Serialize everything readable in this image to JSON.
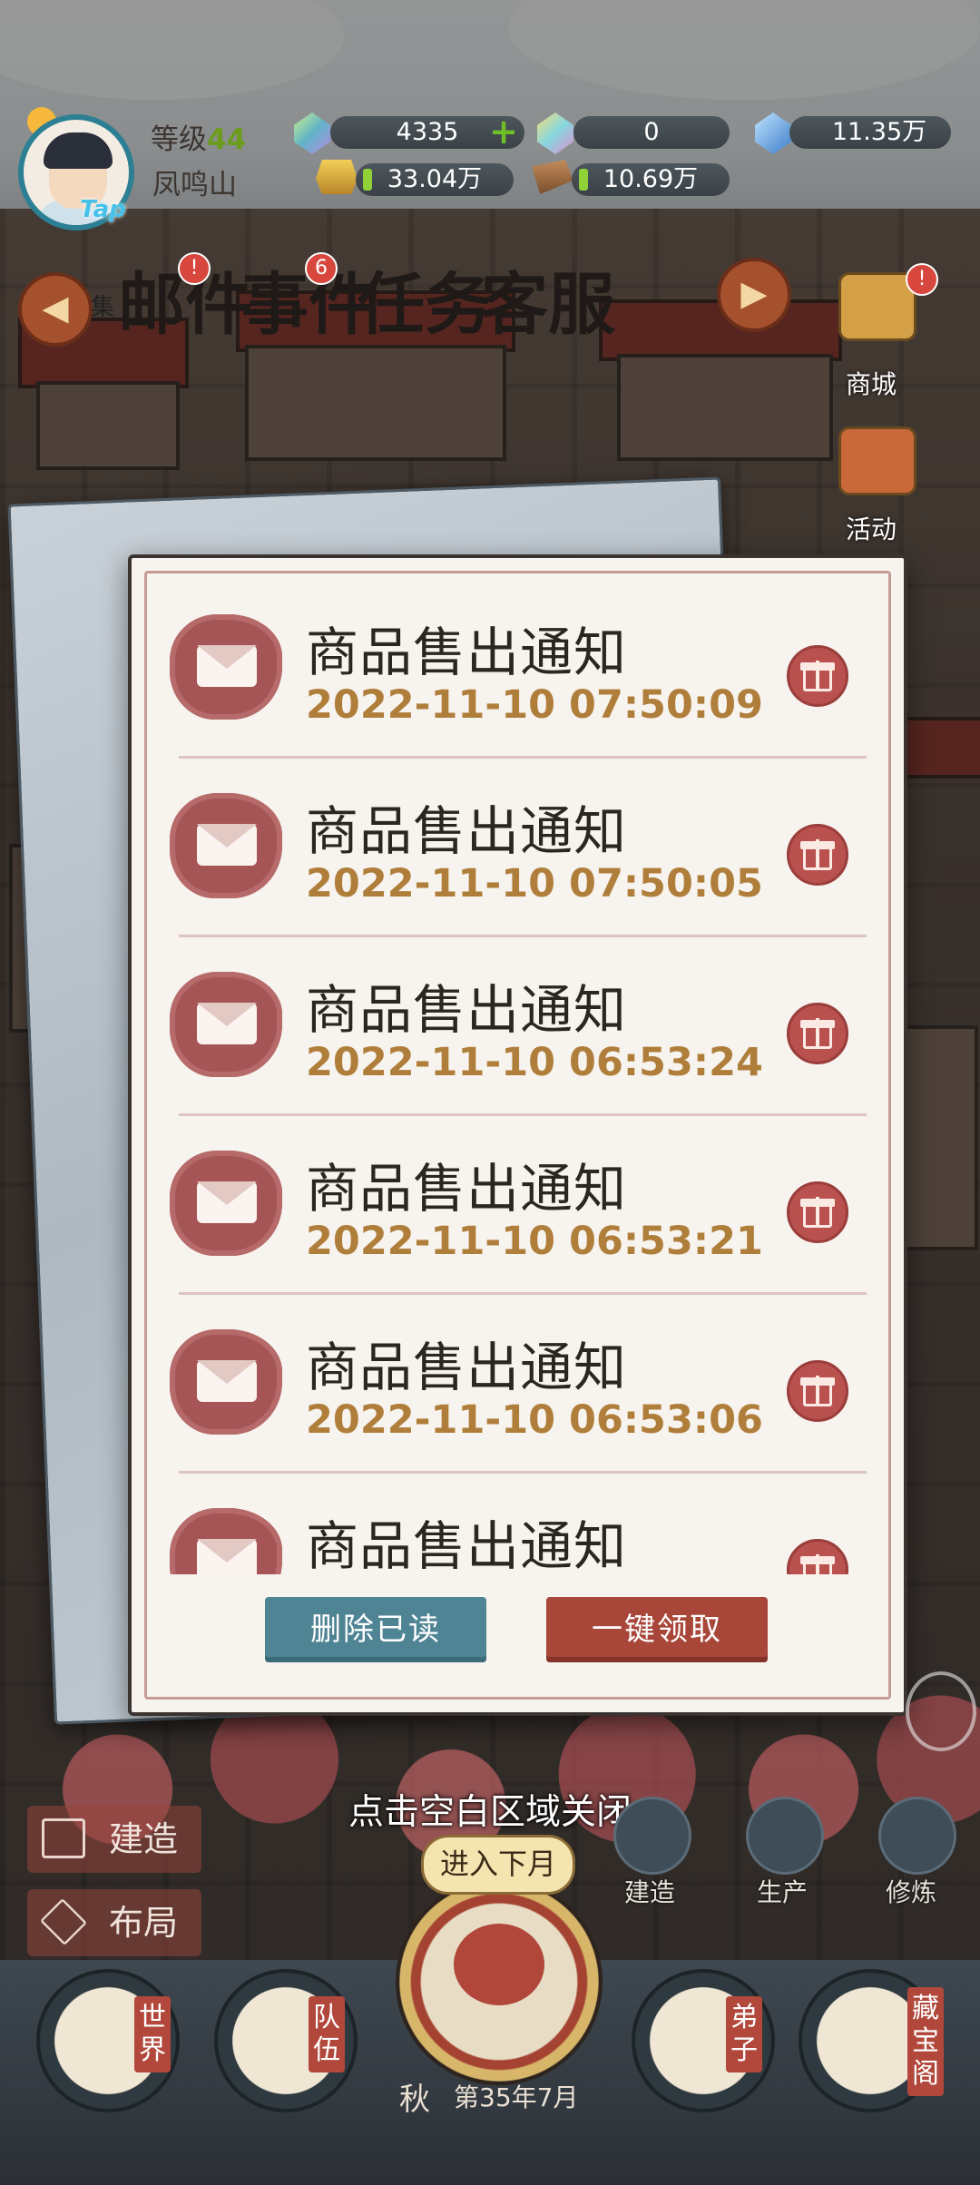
{
  "hud": {
    "level_label": "等级",
    "level_value": "44",
    "sect_name": "凤鸣山",
    "avatar_badge": "Tap",
    "resources": [
      {
        "name": "spirit-jade",
        "value": "4335",
        "icon": "green-crystal-icon"
      },
      {
        "name": "rainbow-jade",
        "value": "0",
        "icon": "rainbow-crystal-icon"
      },
      {
        "name": "blue-stone",
        "value": "11.35万",
        "icon": "blue-gem-icon"
      },
      {
        "name": "gold",
        "value": "33.04万",
        "icon": "gold-ingot-icon"
      },
      {
        "name": "wood",
        "value": "10.69万",
        "icon": "wood-log-icon"
      }
    ]
  },
  "top_menu": {
    "items": [
      {
        "label": "邮件",
        "badge": "!"
      },
      {
        "label": "事件",
        "badge": "6"
      },
      {
        "label": "任务",
        "badge": ""
      },
      {
        "label": "客服",
        "badge": ""
      }
    ],
    "left_nav_partial": "集",
    "shop_label": "商城",
    "activity_label": "活动"
  },
  "mail": {
    "items": [
      {
        "title": "商品售出通知",
        "time": "2022-11-10 07:50:09"
      },
      {
        "title": "商品售出通知",
        "time": "2022-11-10 07:50:05"
      },
      {
        "title": "商品售出通知",
        "time": "2022-11-10 06:53:24"
      },
      {
        "title": "商品售出通知",
        "time": "2022-11-10 06:53:21"
      },
      {
        "title": "商品售出通知",
        "time": "2022-11-10 06:53:06"
      },
      {
        "title": "商品售出通知",
        "time": ""
      }
    ],
    "delete_read_label": "删除已读",
    "claim_all_label": "一键领取",
    "close_hint": "点击空白区域关闭"
  },
  "bottom": {
    "build_label": "建造",
    "layout_label": "布局",
    "next_month_label": "进入下月",
    "season": "秋",
    "date": "第35年7月",
    "tools": [
      {
        "label": "建造"
      },
      {
        "label": "生产"
      },
      {
        "label": "修炼"
      }
    ],
    "nav": [
      {
        "label": "世界"
      },
      {
        "label": "队伍"
      },
      {
        "label": "弟子"
      },
      {
        "label": "藏宝阁"
      }
    ]
  },
  "colors": {
    "accent_red": "#a8463a",
    "accent_teal": "#4f8494",
    "time_gold": "#b07e3b",
    "panel_bg": "#f7f3ee"
  }
}
